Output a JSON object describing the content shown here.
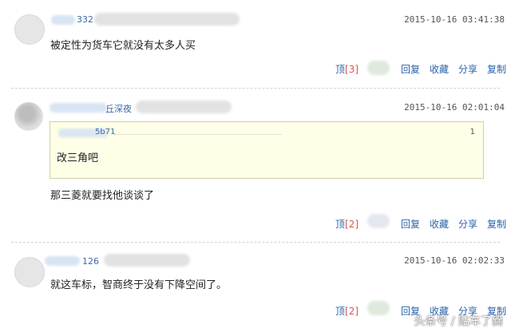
{
  "comments": [
    {
      "user_suffix": "332",
      "time": "2015-10-16 03:41:38",
      "text": "被定性为货车它就没有太多人买",
      "actions": {
        "up_label": "顶",
        "up_count": "[3]",
        "reply": "回复",
        "favorite": "收藏",
        "share": "分享",
        "copy": "复制"
      }
    },
    {
      "user_suffix": "丘深夜",
      "time": "2015-10-16 02:01:04",
      "quote": {
        "header": "5b71",
        "floor": "1",
        "text": "改三角吧"
      },
      "text": "那三菱就要找他谈谈了",
      "actions": {
        "up_label": "顶",
        "up_count": "[2]",
        "reply": "回复",
        "favorite": "收藏",
        "share": "分享",
        "copy": "复制"
      }
    },
    {
      "user_suffix": "126",
      "time": "2015-10-16 02:02:33",
      "text": "就这车标，智商终于没有下降空间了。",
      "actions": {
        "up_label": "顶",
        "up_count": "[2]",
        "reply": "回复",
        "favorite": "收藏",
        "share": "分享",
        "copy": "复制"
      }
    }
  ],
  "watermark": "头条号 / 贴车了爨",
  "colors": {
    "link": "#2a63ad",
    "count": "#d9534f",
    "quote_bg": "#ffffe8"
  }
}
